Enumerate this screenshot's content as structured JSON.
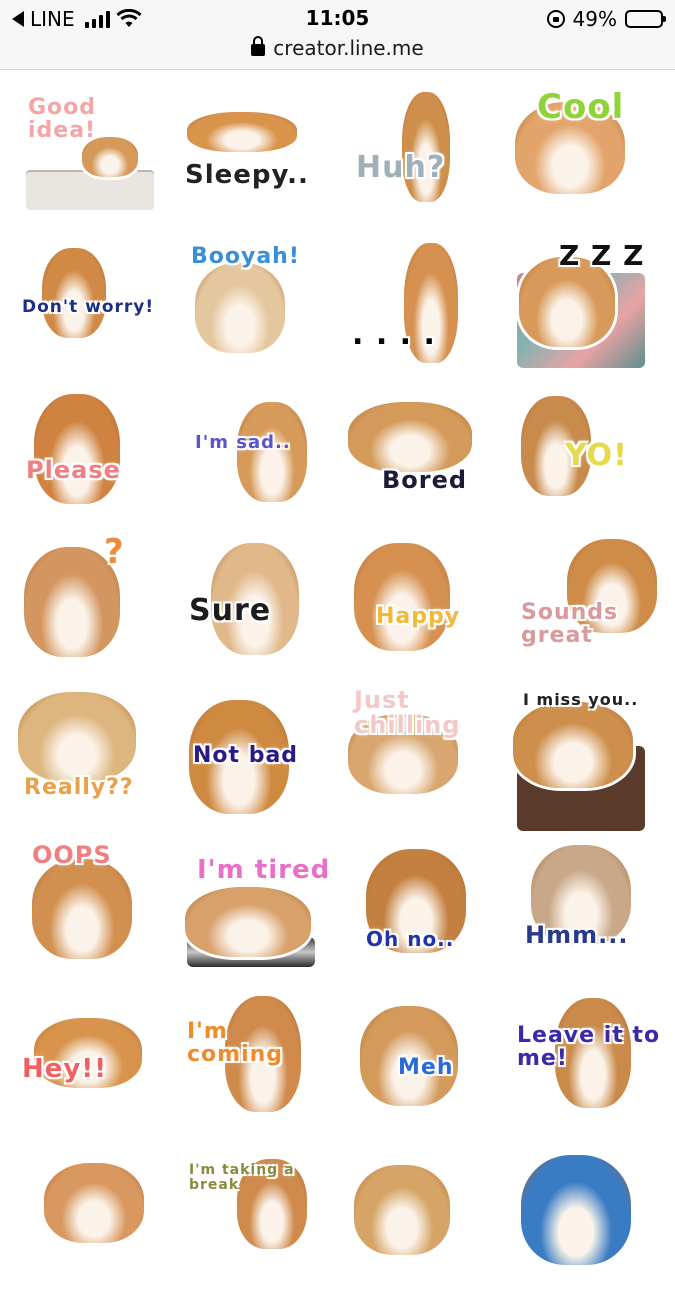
{
  "status_bar": {
    "app_back_label": "LINE",
    "time": "11:05",
    "battery_text": "49%",
    "battery_level": 0.49,
    "battery_color": "#f5c531",
    "url": "creator.line.me",
    "icons": [
      "back-arrow-icon",
      "signal-icon",
      "wifi-icon",
      "rotation-lock-icon",
      "battery-icon",
      "padlock-icon"
    ]
  },
  "stickers": [
    {
      "caption": "Good idea!",
      "color": "#f4a6a6"
    },
    {
      "caption": "Sleepy..",
      "color": "#222222"
    },
    {
      "caption": "Huh?",
      "color": "#9fb0b8"
    },
    {
      "caption": "Cool",
      "color": "#8fd33a"
    },
    {
      "caption": "Don't worry!",
      "color": "#1b2f88"
    },
    {
      "caption": "Booyah!",
      "color": "#3b8fd8"
    },
    {
      "caption": ". . . .",
      "color": "#000000"
    },
    {
      "caption": "Z Z Z",
      "color": "#111111"
    },
    {
      "caption": "Please",
      "color": "#f08080"
    },
    {
      "caption": "I'm sad..",
      "color": "#5a55c8"
    },
    {
      "caption": "Bored",
      "color": "#1c1c3a"
    },
    {
      "caption": "YO!",
      "color": "#e8d94a"
    },
    {
      "caption": "?",
      "color": "#f08a3a"
    },
    {
      "caption": "Sure",
      "color": "#1c1c1c"
    },
    {
      "caption": "Happy",
      "color": "#f2b83a"
    },
    {
      "caption": "Sounds great",
      "color": "#d89a9a"
    },
    {
      "caption": "Really??",
      "color": "#e8a04a"
    },
    {
      "caption": "Not bad",
      "color": "#2a1a88"
    },
    {
      "caption": "Just chilling",
      "color": "#f2c8c8"
    },
    {
      "caption": "I miss you..",
      "color": "#222222"
    },
    {
      "caption": "OOPS",
      "color": "#f08080"
    },
    {
      "caption": "I'm tired",
      "color": "#e870c8"
    },
    {
      "caption": "Oh no..",
      "color": "#2233aa"
    },
    {
      "caption": "Hmm...",
      "color": "#2a3a8a"
    },
    {
      "caption": "Hey!!",
      "color": "#f06060"
    },
    {
      "caption": "I'm coming",
      "color": "#f08a2a"
    },
    {
      "caption": "Meh",
      "color": "#2a6ad8"
    },
    {
      "caption": "Leave it to me!",
      "color": "#3a2aa8"
    },
    {
      "caption": "",
      "color": "#000000"
    },
    {
      "caption": "I'm taking a break",
      "color": "#8a8a3a"
    },
    {
      "caption": "",
      "color": "#000000"
    },
    {
      "caption": "",
      "color": "#000000"
    }
  ]
}
